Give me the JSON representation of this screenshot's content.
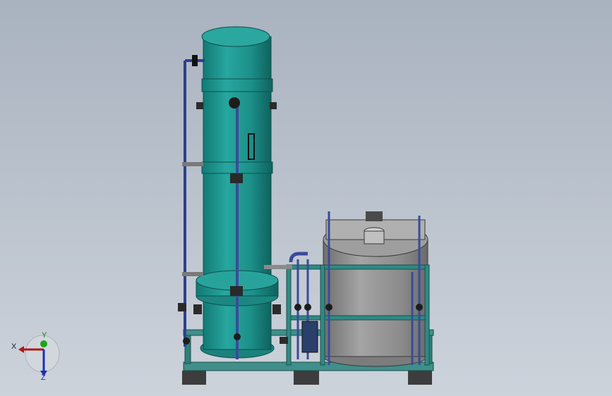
{
  "triad": {
    "x_label": "X",
    "y_label": "Y",
    "z_label": "Z",
    "colors": {
      "x": "#b01818",
      "y": "#1aa51a",
      "z": "#1c2fb0"
    }
  },
  "model": {
    "colors": {
      "tank_teal": "#1e958f",
      "tank_dark": "#136a66",
      "tank_light": "#4fc2ba",
      "drum_gray": "#8e8e8e",
      "frame_teal": "#247e7a",
      "pipe_blue": "#3c4fa0",
      "base_dark": "#3a3a3a"
    }
  }
}
